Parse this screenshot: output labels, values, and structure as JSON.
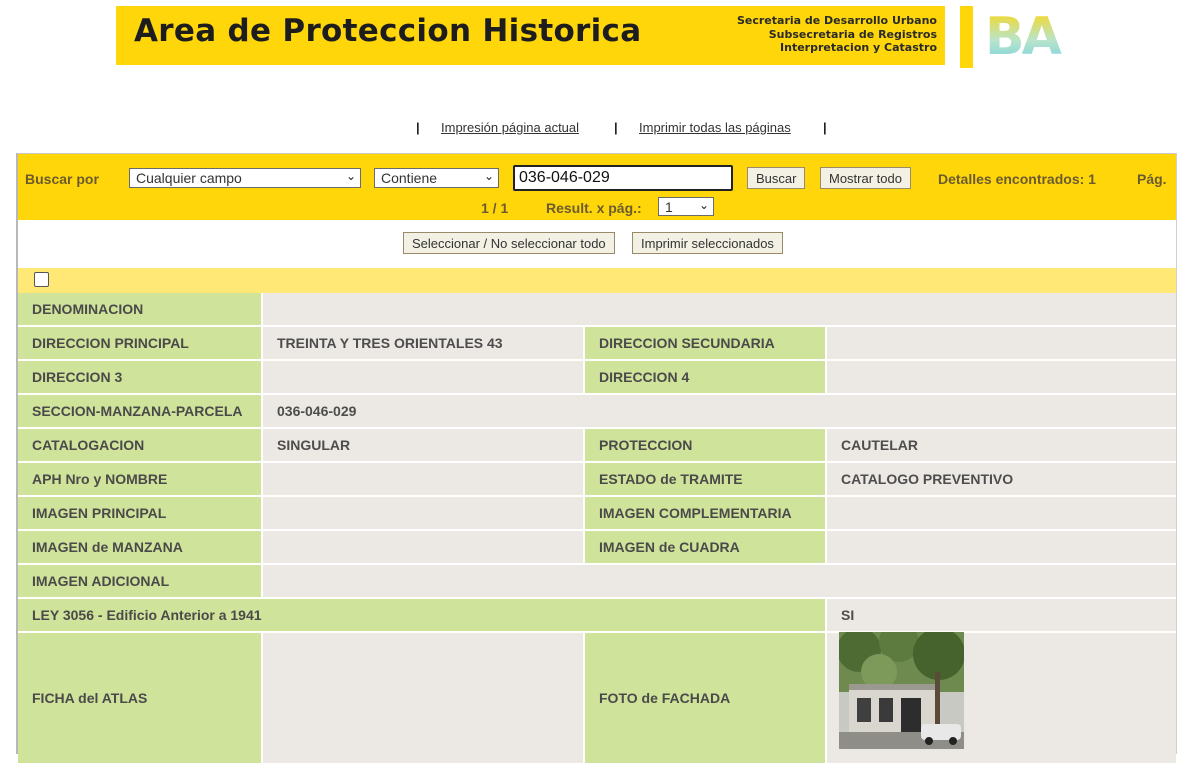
{
  "header": {
    "title": "Area de Proteccion Historica",
    "org_lines": [
      "Secretaria de Desarrollo Urbano",
      "Subsecretaria de Registros",
      "Interpretacion y Catastro"
    ],
    "logo_text": "BA"
  },
  "print_links": {
    "current_page": "Impresión página actual",
    "all_pages": "Imprimir todas las páginas",
    "separator": "|"
  },
  "search": {
    "label": "Buscar por",
    "field_select": "Cualquier campo",
    "operator_select": "Contiene",
    "query": "036-046-029",
    "search_button": "Buscar",
    "show_all_button": "Mostrar todo",
    "found_text": "Detalles encontrados: 1",
    "page_label": "Pág.",
    "pagination": "1 / 1",
    "per_page_label": "Result. x pág.:",
    "per_page_value": "1"
  },
  "actions": {
    "select_all": "Seleccionar / No seleccionar todo",
    "print_selected": "Imprimir seleccionados"
  },
  "record": {
    "denominacion_label": "DENOMINACION",
    "denominacion": "",
    "dir_principal_label": "DIRECCION PRINCIPAL",
    "dir_principal": "TREINTA Y TRES ORIENTALES 43",
    "dir_secundaria_label": "DIRECCION SECUNDARIA",
    "dir_secundaria": "",
    "dir3_label": "DIRECCION 3",
    "dir3": "",
    "dir4_label": "DIRECCION 4",
    "dir4": "",
    "smp_label": "SECCION-MANZANA-PARCELA",
    "smp": "036-046-029",
    "catalogacion_label": "CATALOGACION",
    "catalogacion": "SINGULAR",
    "proteccion_label": "PROTECCION",
    "proteccion": "CAUTELAR",
    "aph_label": "APH Nro y NOMBRE",
    "aph": "",
    "estado_label": "ESTADO de TRAMITE",
    "estado": "CATALOGO PREVENTIVO",
    "img_principal_label": "IMAGEN PRINCIPAL",
    "img_principal": "",
    "img_complementaria_label": "IMAGEN COMPLEMENTARIA",
    "img_complementaria": "",
    "img_manzana_label": "IMAGEN de MANZANA",
    "img_manzana": "",
    "img_cuadra_label": "IMAGEN de CUADRA",
    "img_cuadra": "",
    "img_adicional_label": "IMAGEN ADICIONAL",
    "img_adicional": "",
    "ley_label": "LEY 3056 - Edificio Anterior a 1941",
    "ley": "SI",
    "ficha_label": "FICHA del ATLAS",
    "ficha": "",
    "foto_label": "FOTO de FACHADA"
  },
  "colors": {
    "yellow": "#ffd60a",
    "label_green": "#d0e39a",
    "value_gray": "#ece9e4"
  }
}
